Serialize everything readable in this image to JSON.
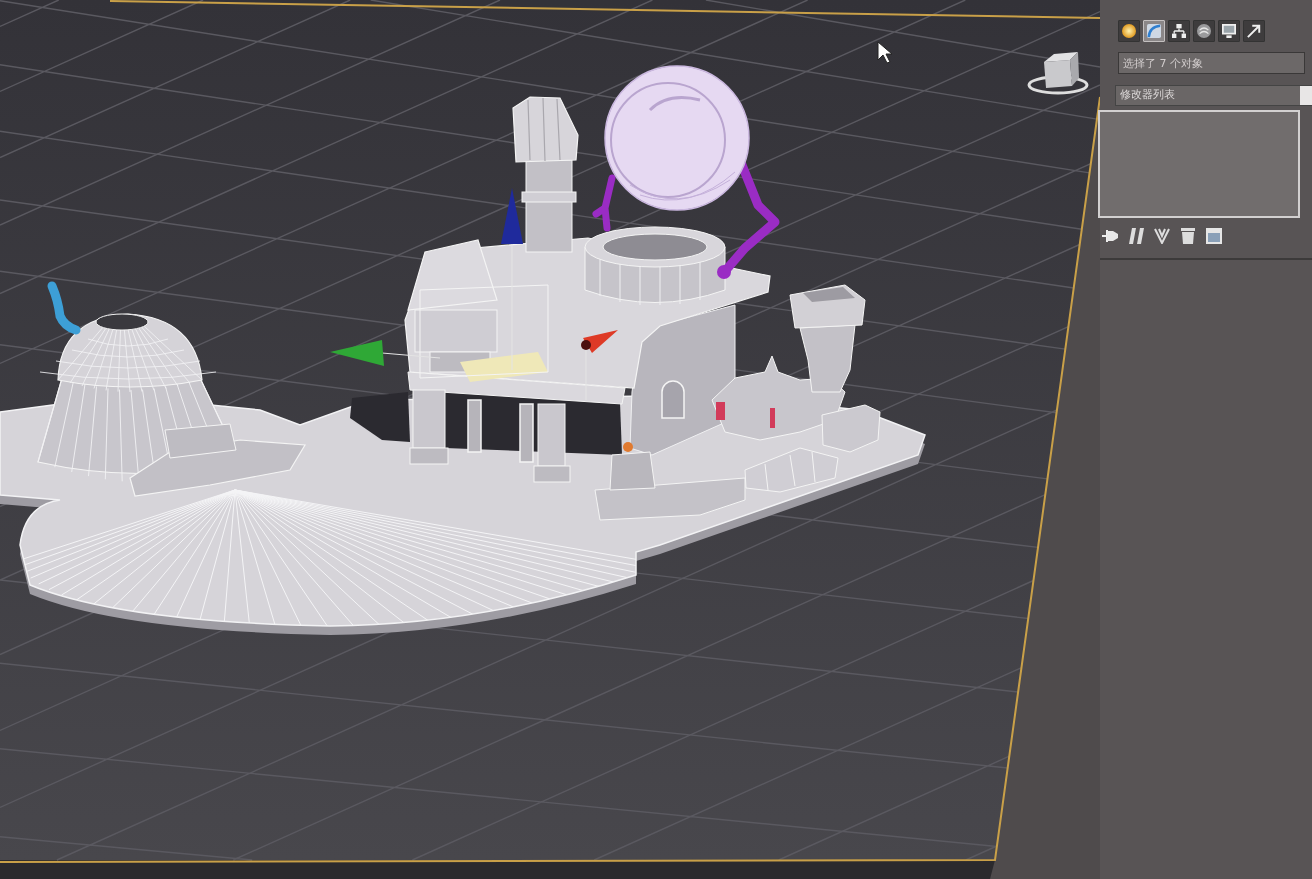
{
  "command_panel": {
    "tabs": [
      {
        "kind": "create",
        "selected": false
      },
      {
        "kind": "modify",
        "selected": true
      },
      {
        "kind": "hierarchy",
        "selected": false
      },
      {
        "kind": "motion",
        "selected": false
      },
      {
        "kind": "display",
        "selected": false
      },
      {
        "kind": "utilities",
        "selected": false
      }
    ],
    "name_field": {
      "value": "选择了 7 个对象"
    },
    "modifier_list": {
      "label": "修改器列表"
    },
    "stack_tools": [
      {
        "kind": "pin"
      },
      {
        "kind": "show_end_result"
      },
      {
        "kind": "make_unique"
      },
      {
        "kind": "remove_modifier"
      },
      {
        "kind": "configure_sets"
      }
    ]
  }
}
